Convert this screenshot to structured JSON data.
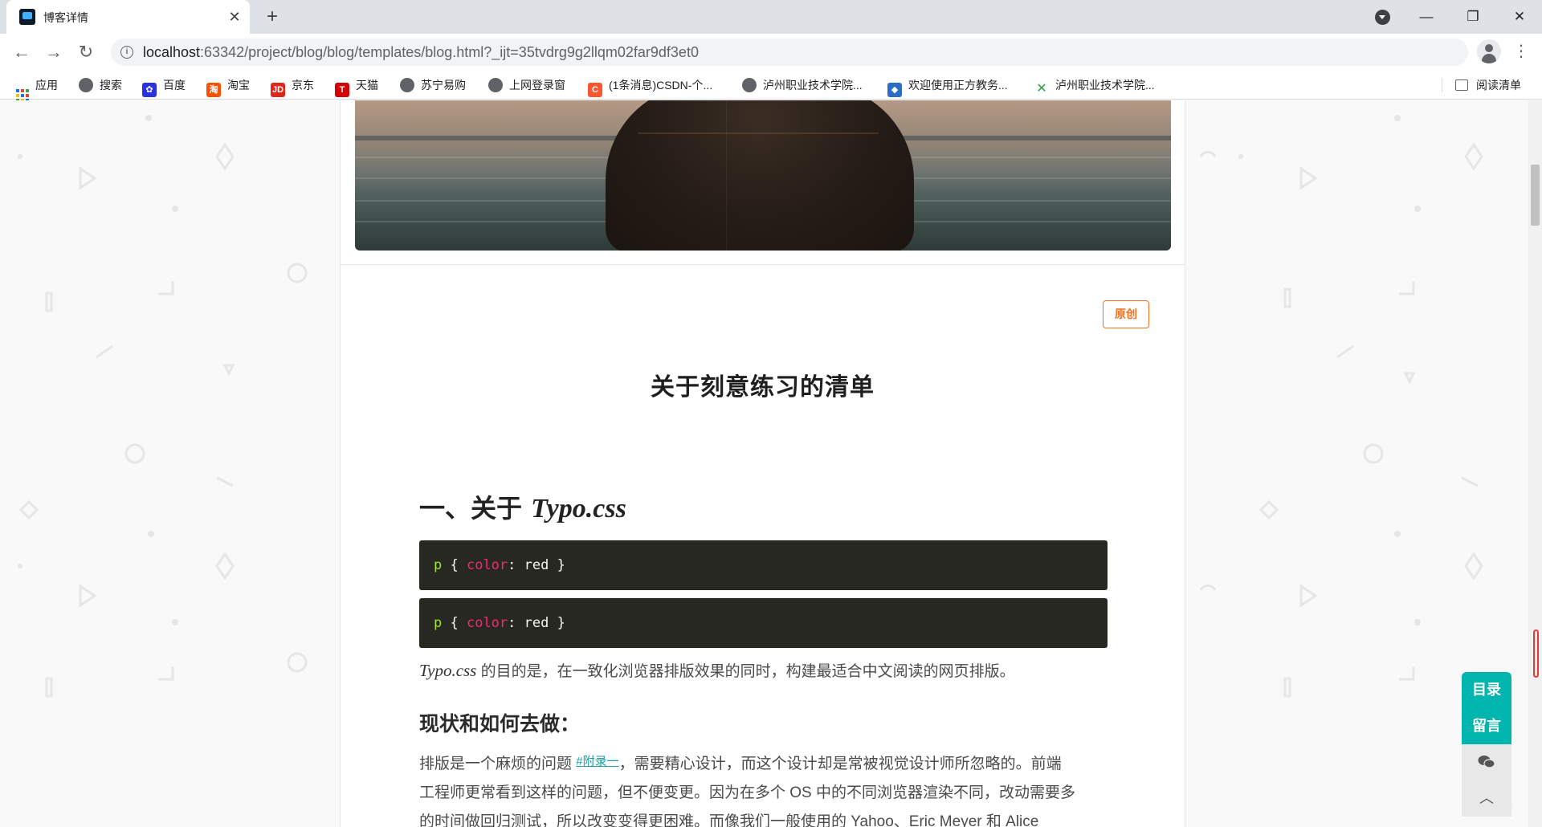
{
  "browser": {
    "tab_title": "博客详情",
    "tab_close": "✕",
    "new_tab": "+",
    "url_host": "localhost",
    "url_rest": ":63342/project/blog/blog/templates/blog.html?_ijt=35tvdrg9g2llqm02far9df3et0",
    "window_controls": [
      "—",
      "❐",
      "✕"
    ]
  },
  "bookmarks": [
    {
      "label": "应用",
      "icon": "apps-icon"
    },
    {
      "label": "搜索",
      "icon": "globe-icon"
    },
    {
      "label": "百度",
      "icon": "baidu-icon"
    },
    {
      "label": "淘宝",
      "icon": "taobao-icon"
    },
    {
      "label": "京东",
      "icon": "jd-icon"
    },
    {
      "label": "天猫",
      "icon": "tmall-icon"
    },
    {
      "label": "苏宁易购",
      "icon": "globe-icon"
    },
    {
      "label": "上网登录窗",
      "icon": "globe-icon"
    },
    {
      "label": "(1条消息)CSDN-个...",
      "icon": "csdn-icon"
    },
    {
      "label": "泸州职业技术学院...",
      "icon": "globe-icon"
    },
    {
      "label": "欢迎使用正方教务...",
      "icon": "zf-icon"
    },
    {
      "label": "泸州职业技术学院...",
      "icon": "school-icon"
    }
  ],
  "reading_list": "阅读清单",
  "article": {
    "badge": "原创",
    "title": "关于刻意练习的清单",
    "h2_prefix": "一、关于 ",
    "h2_em": "Typo.css",
    "code_blocks": [
      {
        "selector": "p",
        "open": " { ",
        "prop": "color",
        "colon": ": ",
        "value": "red",
        "close": " }"
      },
      {
        "selector": "p",
        "open": " { ",
        "prop": "color",
        "colon": ": ",
        "value": "red",
        "close": " }"
      }
    ],
    "intro_em": "Typo.css",
    "intro_rest": " 的目的是，在一致化浏览器排版效果的同时，构建最适合中文阅读的网页排版。",
    "h3": "现状和如何去做：",
    "para_start": "排版是一个麻烦的问题 ",
    "para_link": "#附录一",
    "para_line1_rest": "，需要精心设计，而这个设计却是常被视觉设计师所忽略的。前端",
    "para_line2": "工程师更常看到这样的问题，但不便变更。因为在多个 OS 中的不同浏览器渲染不同，改动需要多",
    "para_line3": "的时间做回归测试，所以改变变得更困难。而像我们一般使用的 Yahoo、Eric Meyer 和 Alice"
  },
  "side_menu": {
    "toc": "目录",
    "comment": "留言",
    "wechat_icon": "wechat-icon",
    "top_icon": "chevron-up-icon"
  },
  "colors": {
    "accent_teal": "#00b5ad",
    "badge_orange": "#f2711c",
    "code_bg": "#272822"
  }
}
